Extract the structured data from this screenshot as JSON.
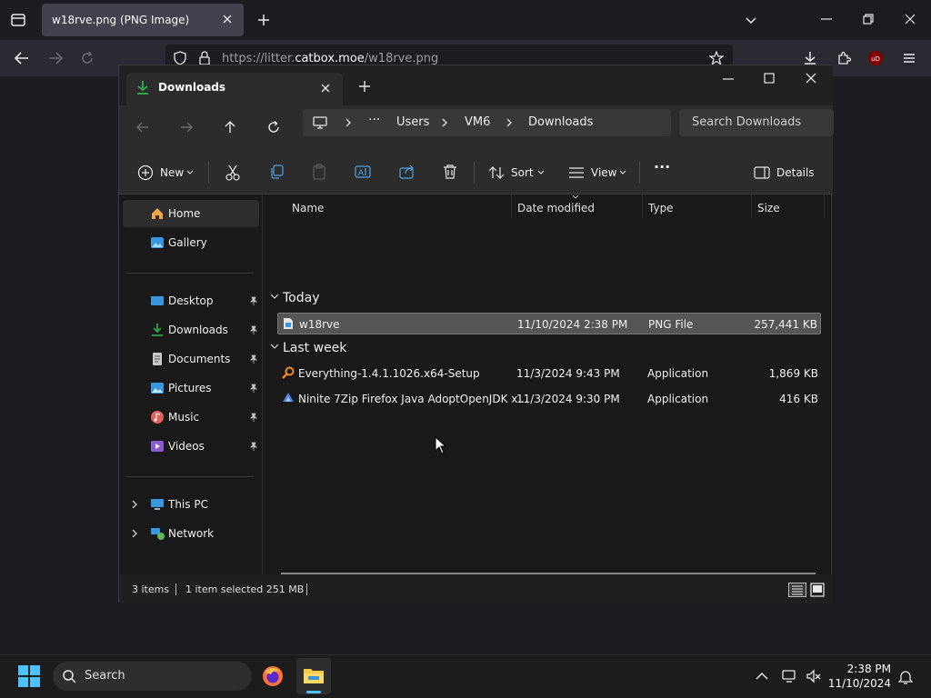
{
  "browser": {
    "tab_title": "w18rve.png (PNG Image)",
    "url_prefix": "https://litter.",
    "url_domain": "catbox.moe",
    "url_path": "/w18rve.png"
  },
  "explorer": {
    "tab_title": "Downloads",
    "breadcrumb": [
      "Users",
      "VM6",
      "Downloads"
    ],
    "breadcrumb_more": "···",
    "search_placeholder": "Search Downloads",
    "toolbar": {
      "new": "New",
      "sort": "Sort",
      "view": "View",
      "more": "···",
      "details": "Details"
    },
    "nav": {
      "home": "Home",
      "gallery": "Gallery",
      "desktop": "Desktop",
      "downloads": "Downloads",
      "documents": "Documents",
      "pictures": "Pictures",
      "music": "Music",
      "videos": "Videos",
      "thispc": "This PC",
      "network": "Network"
    },
    "columns": {
      "name": "Name",
      "date": "Date modified",
      "type": "Type",
      "size": "Size"
    },
    "groups": {
      "today": "Today",
      "lastweek": "Last week"
    },
    "files": [
      {
        "name": "w18rve",
        "date": "11/10/2024 2:38 PM",
        "type": "PNG File",
        "size": "257,441 KB"
      },
      {
        "name": "Everything-1.4.1.1026.x64-Setup",
        "date": "11/3/2024 9:43 PM",
        "type": "Application",
        "size": "1,869 KB"
      },
      {
        "name": "Ninite 7Zip Firefox Java AdoptOpenJDK x...",
        "date": "11/3/2024 9:30 PM",
        "type": "Application",
        "size": "416 KB"
      }
    ],
    "status": {
      "count": "3 items",
      "selected": "1 item selected  251 MB"
    }
  },
  "taskbar": {
    "search": "Search",
    "time": "2:38 PM",
    "date": "11/10/2024"
  },
  "colors": {
    "selection": "#555555",
    "accent": "#0078d4",
    "window_bg": "#191919"
  }
}
